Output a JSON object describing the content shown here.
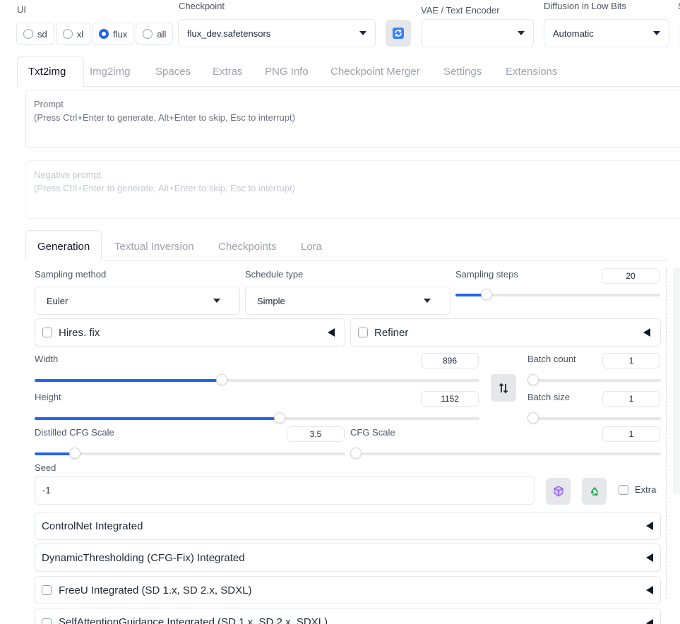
{
  "top": {
    "ui_label": "UI",
    "ui_options": [
      "sd",
      "xl",
      "flux",
      "all"
    ],
    "ui_selected": "flux",
    "checkpoint_label": "Checkpoint",
    "checkpoint_value": "flux_dev.safetensors",
    "vae_label": "VAE / Text Encoder",
    "vae_value": "",
    "diffusion_label": "Diffusion in Low Bits",
    "diffusion_value": "Automatic",
    "cut_label": "S"
  },
  "tabs": [
    "Txt2img",
    "Img2img",
    "Spaces",
    "Extras",
    "PNG Info",
    "Checkpoint Merger",
    "Settings",
    "Extensions"
  ],
  "active_tab": "Txt2img",
  "prompt": {
    "label": "Prompt",
    "placeholder": "(Press Ctrl+Enter to generate, Alt+Enter to skip, Esc to interrupt)"
  },
  "negative_prompt": {
    "label": "Negative prompt",
    "placeholder": "(Press Ctrl+Enter to generate, Alt+Enter to skip, Esc to interrupt)"
  },
  "subtabs": [
    "Generation",
    "Textual Inversion",
    "Checkpoints",
    "Lora"
  ],
  "active_subtab": "Generation",
  "sampling": {
    "method_label": "Sampling method",
    "method_value": "Euler",
    "schedule_label": "Schedule type",
    "schedule_value": "Simple",
    "steps_label": "Sampling steps",
    "steps_value": "20",
    "steps_fraction": 0.15
  },
  "hires_label": "Hires. fix",
  "refiner_label": "Refiner",
  "width": {
    "label": "Width",
    "value": "896",
    "fraction": 0.42
  },
  "height": {
    "label": "Height",
    "value": "1152",
    "fraction": 0.55
  },
  "batch_count": {
    "label": "Batch count",
    "value": "1",
    "fraction": 0.0
  },
  "batch_size": {
    "label": "Batch size",
    "value": "1",
    "fraction": 0.0
  },
  "distilled_cfg": {
    "label": "Distilled CFG Scale",
    "value": "3.5",
    "fraction": 0.13
  },
  "cfg": {
    "label": "CFG Scale",
    "value": "1",
    "fraction": 0.0
  },
  "seed": {
    "label": "Seed",
    "value": "-1",
    "extra_label": "Extra"
  },
  "accordions": [
    {
      "label": "ControlNet Integrated",
      "checkbox": false
    },
    {
      "label": "DynamicThresholding (CFG-Fix) Integrated",
      "checkbox": false
    },
    {
      "label": "FreeU Integrated (SD 1.x, SD 2.x, SDXL)",
      "checkbox": true
    },
    {
      "label": "SelfAttentionGuidance Integrated (SD 1.x, SD 2.x, SDXL)",
      "checkbox": true
    }
  ],
  "colors": {
    "accent": "#2563eb",
    "border": "#e5e7eb",
    "muted": "#9ca3af"
  },
  "icons": [
    "refresh-icon",
    "dropdown-arrow-icon",
    "swap-dimensions-icon",
    "dice-icon",
    "recycle-icon",
    "collapse-triangle-icon"
  ]
}
